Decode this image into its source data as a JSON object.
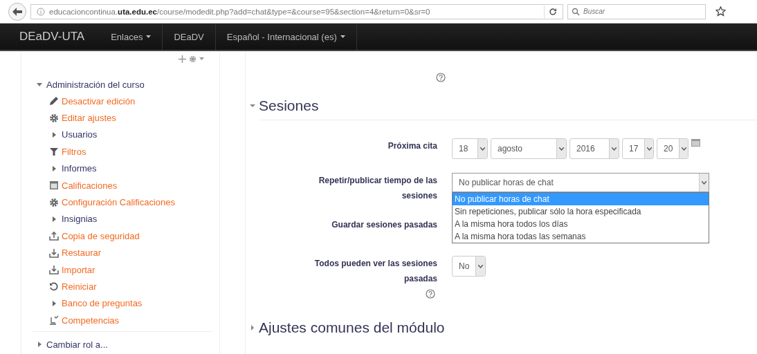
{
  "browser": {
    "url": "educacioncontinua.**uta.edu.ec**/course/modedit.php?add=chat&type=&course=95&section=4&return=0&sr=0",
    "search": {
      "placeholder": "Buscar"
    }
  },
  "navbar": {
    "brand": "DEaDV-UTA",
    "items": [
      {
        "label": "Enlaces",
        "dropdown": true
      },
      {
        "label": "DEaDV",
        "dropdown": false
      },
      {
        "label": "Español - Internacional (es)",
        "dropdown": true
      }
    ]
  },
  "sidebar": {
    "nodes": [
      {
        "label": "Administración del curso",
        "expanded": true,
        "children": [
          {
            "kind": "edit",
            "label": "Desactivar edición",
            "link": true
          },
          {
            "kind": "settings",
            "label": "Editar ajustes",
            "link": true
          },
          {
            "kind": "branch",
            "label": "Usuarios",
            "link": false
          },
          {
            "kind": "filter",
            "label": "Filtros",
            "link": true
          },
          {
            "kind": "branch",
            "label": "Informes",
            "link": false
          },
          {
            "kind": "grades",
            "label": "Calificaciones",
            "link": true
          },
          {
            "kind": "settings",
            "label": "Configuración Calificaciones",
            "link": true
          },
          {
            "kind": "branch",
            "label": "Insignias",
            "link": false
          },
          {
            "kind": "backup",
            "label": "Copia de seguridad",
            "link": true
          },
          {
            "kind": "restore",
            "label": "Restaurar",
            "link": true
          },
          {
            "kind": "restore",
            "label": "Importar",
            "link": true
          },
          {
            "kind": "reset",
            "label": "Reiniciar",
            "link": true
          },
          {
            "kind": "branch",
            "label": "Banco de preguntas",
            "link": true
          },
          {
            "kind": "competencies",
            "label": "Competencias",
            "link": true
          }
        ]
      },
      {
        "label": "Cambiar rol a...",
        "expanded": false
      }
    ]
  },
  "form": {
    "top_help": true,
    "sections": [
      {
        "title": "Sesiones",
        "expanded": true,
        "fields": [
          {
            "kind": "date",
            "label": "Próxima cita",
            "parts": [
              "18",
              "agosto",
              "2016",
              "17",
              "20"
            ]
          },
          {
            "kind": "select",
            "label": "Repetir/publicar tiempo de las sesiones",
            "value": "No publicar horas de chat",
            "open": true,
            "options": [
              {
                "label": "No publicar horas de chat",
                "selected": true
              },
              {
                "label": "Sin repeticiones, publicar sólo la hora especificada",
                "selected": false
              },
              {
                "label": "A la misma hora todos los días",
                "selected": false
              },
              {
                "label": "A la misma hora todas las semanas",
                "selected": false
              }
            ]
          },
          {
            "kind": "hidden",
            "label": "Guardar sesiones pasadas"
          },
          {
            "kind": "select",
            "label": "Todos pueden ver las sesiones pasadas",
            "value": "No",
            "open": false,
            "help": true
          }
        ]
      },
      {
        "title": "Ajustes comunes del módulo",
        "expanded": false
      }
    ]
  }
}
